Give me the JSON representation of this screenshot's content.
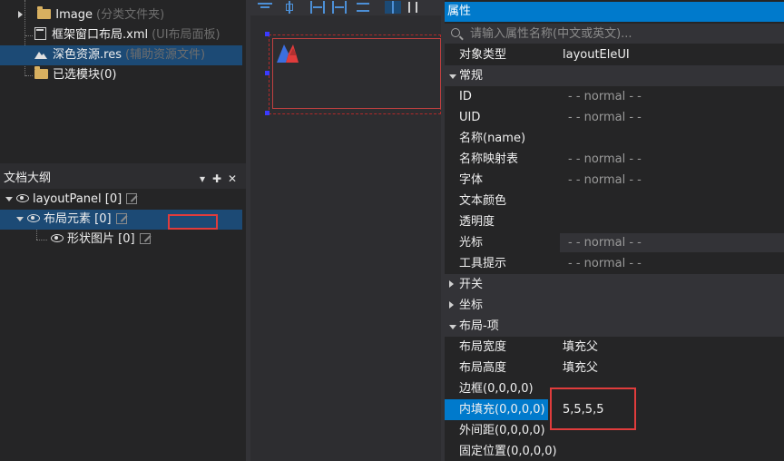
{
  "resource_tree": {
    "items": [
      {
        "label": "Image",
        "hint": "(分类文件夹)"
      },
      {
        "label": "框架窗口布局.xml",
        "hint": "(UI布局面板)"
      },
      {
        "label": "深色资源.res",
        "hint": "(辅助资源文件)"
      },
      {
        "label": "已选模块(0)",
        "hint": ""
      }
    ]
  },
  "outline": {
    "title": "文档大纲",
    "pin_glyph": "✚",
    "close_glyph": "✕",
    "menu_glyph": "▾",
    "items": [
      {
        "label": "layoutPanel [0]"
      },
      {
        "label": "布局元素 [0]"
      },
      {
        "label": "形状图片 [0]"
      }
    ]
  },
  "properties": {
    "title": "属性",
    "search_placeholder": "请输入属性名称(中文或英文)...",
    "rows": [
      {
        "type": "prop",
        "name": "对象类型",
        "value": "layoutEleUI"
      },
      {
        "type": "cat",
        "name": "常规"
      },
      {
        "type": "prop",
        "name": "ID",
        "value": "- - normal - -"
      },
      {
        "type": "prop",
        "name": "UID",
        "value": "- - normal - -"
      },
      {
        "type": "prop",
        "name": "名称(name)",
        "value": ""
      },
      {
        "type": "prop",
        "name": "名称映射表",
        "value": "- - normal - -"
      },
      {
        "type": "prop",
        "name": "字体",
        "value": "- - normal - -"
      },
      {
        "type": "prop",
        "name": "文本颜色",
        "value": ""
      },
      {
        "type": "prop",
        "name": "透明度",
        "value": ""
      },
      {
        "type": "prop",
        "name": "光标",
        "value": "- - normal - -"
      },
      {
        "type": "prop",
        "name": "工具提示",
        "value": "- - normal - -"
      },
      {
        "type": "cat",
        "name": "开关"
      },
      {
        "type": "cat",
        "name": "坐标"
      },
      {
        "type": "cat",
        "name": "布局-项"
      },
      {
        "type": "prop",
        "name": "布局宽度",
        "value": "填充父"
      },
      {
        "type": "prop",
        "name": "布局高度",
        "value": "填充父"
      },
      {
        "type": "prop",
        "name": "边框(0,0,0,0)",
        "value": ""
      },
      {
        "type": "prop",
        "name": "内填充(0,0,0,0)",
        "value": "5,5,5,5"
      },
      {
        "type": "prop",
        "name": "外间距(0,0,0,0)",
        "value": ""
      },
      {
        "type": "prop",
        "name": "固定位置(0,0,0,0)",
        "value": ""
      }
    ]
  },
  "colors": {
    "accent": "#007acc",
    "selection": "#1c4a75",
    "highlight_box": "#e03c3c",
    "logo_blue": "#3b6fe0",
    "logo_red": "#e03c3c"
  }
}
